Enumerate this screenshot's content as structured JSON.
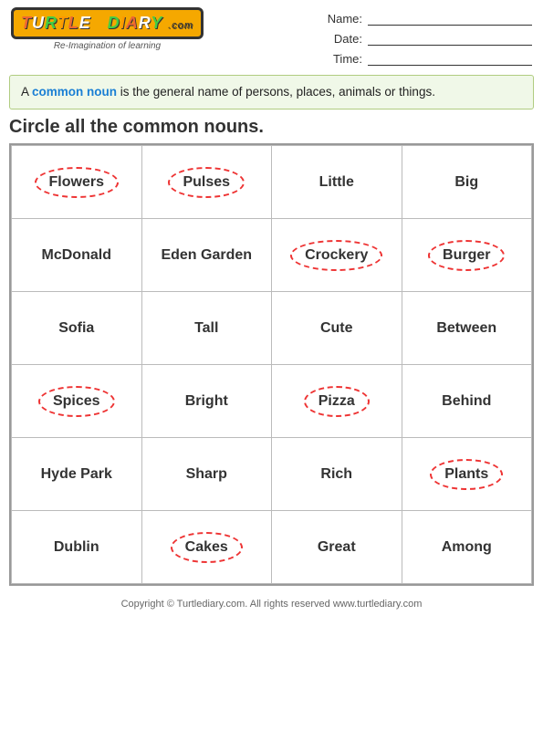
{
  "header": {
    "logo_text": "TURTLE DIARY",
    "logo_sub": "Re-Imagination of learning",
    "logo_com": ".com",
    "name_label": "Name:",
    "date_label": "Date:",
    "time_label": "Time:"
  },
  "info": {
    "text_before": "A ",
    "highlight": "common noun",
    "text_after": " is the general name of persons, places, animals or things."
  },
  "title": "Circle all the common nouns.",
  "grid": [
    [
      {
        "word": "Flowers",
        "circled": true
      },
      {
        "word": "Pulses",
        "circled": true
      },
      {
        "word": "Little",
        "circled": false
      },
      {
        "word": "Big",
        "circled": false
      }
    ],
    [
      {
        "word": "McDonald",
        "circled": false
      },
      {
        "word": "Eden Garden",
        "circled": false
      },
      {
        "word": "Crockery",
        "circled": true
      },
      {
        "word": "Burger",
        "circled": true
      }
    ],
    [
      {
        "word": "Sofia",
        "circled": false
      },
      {
        "word": "Tall",
        "circled": false
      },
      {
        "word": "Cute",
        "circled": false
      },
      {
        "word": "Between",
        "circled": false
      }
    ],
    [
      {
        "word": "Spices",
        "circled": true
      },
      {
        "word": "Bright",
        "circled": false
      },
      {
        "word": "Pizza",
        "circled": true
      },
      {
        "word": "Behind",
        "circled": false
      }
    ],
    [
      {
        "word": "Hyde Park",
        "circled": false
      },
      {
        "word": "Sharp",
        "circled": false
      },
      {
        "word": "Rich",
        "circled": false
      },
      {
        "word": "Plants",
        "circled": true
      }
    ],
    [
      {
        "word": "Dublin",
        "circled": false
      },
      {
        "word": "Cakes",
        "circled": true
      },
      {
        "word": "Great",
        "circled": false
      },
      {
        "word": "Among",
        "circled": false
      }
    ]
  ],
  "footer": "Copyright © Turtlediary.com. All rights reserved  www.turtlediary.com"
}
